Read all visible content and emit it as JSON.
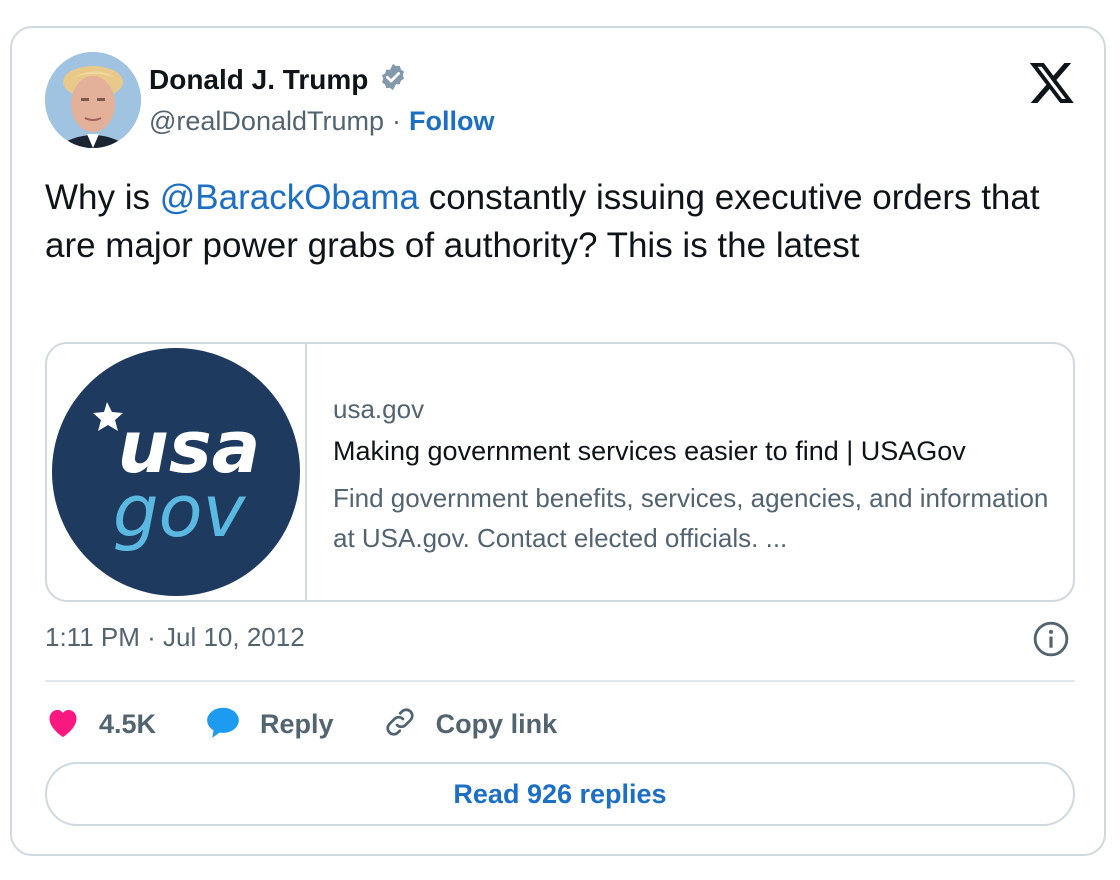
{
  "author": {
    "name": "Donald J. Trump",
    "handle": "@realDonaldTrump",
    "separator": "·",
    "follow_label": "Follow"
  },
  "tweet": {
    "text_before": "Why is ",
    "mention": "@BarackObama",
    "text_after": " constantly issuing executive orders that are major power grabs of authority? This is the latest"
  },
  "link_card": {
    "logo_top": "usa",
    "logo_bottom": "gov",
    "domain": "usa.gov",
    "title": "Making government services easier to find | USAGov",
    "description": "Find government benefits, services, agencies, and information at USA.gov. Contact elected officials. ..."
  },
  "timestamp": "1:11 PM · Jul 10, 2012",
  "actions": {
    "like_count": "4.5K",
    "reply_label": "Reply",
    "copy_link_label": "Copy link"
  },
  "read_replies_label": "Read 926 replies",
  "colors": {
    "link_blue": "#1d6fc4",
    "like_pink": "#f91880",
    "reply_blue": "#1d9bf0",
    "usagov_navy": "#1f3a5f",
    "usagov_light_blue": "#5bb8e0"
  },
  "icons": [
    "verified-badge-icon",
    "x-logo-icon",
    "info-icon",
    "heart-icon",
    "reply-bubble-icon",
    "link-icon"
  ]
}
